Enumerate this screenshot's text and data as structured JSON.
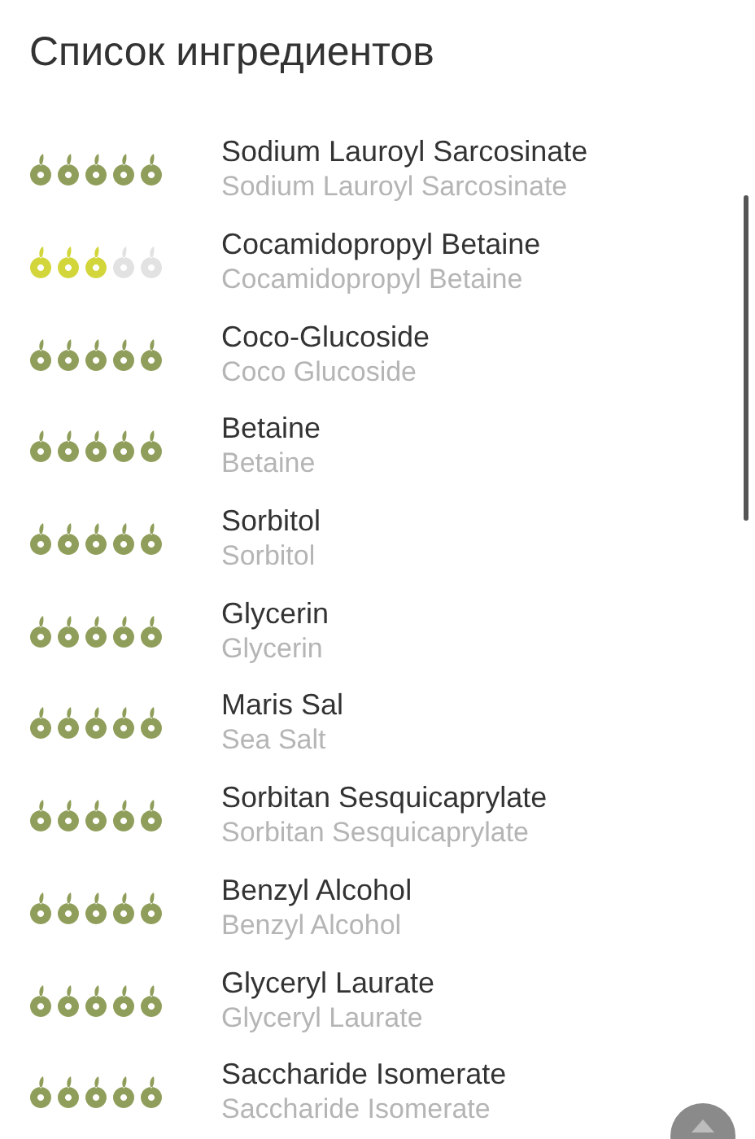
{
  "title": "Список ингредиентов",
  "ingredients": [
    {
      "name": "Sodium Lauroyl Sarcosinate",
      "subtitle": "Sodium Lauroyl Sarcosinate",
      "stars": 5,
      "color": "#8f9e5a"
    },
    {
      "name": "Cocamidopropyl Betaine",
      "subtitle": "Cocamidopropyl Betaine",
      "stars": 3,
      "color": "#d2d63a"
    },
    {
      "name": "Coco-Glucoside",
      "subtitle": "Coco Glucoside",
      "stars": 5,
      "color": "#8f9e5a"
    },
    {
      "name": "Betaine",
      "subtitle": "Betaine",
      "stars": 5,
      "color": "#8f9e5a"
    },
    {
      "name": "Sorbitol",
      "subtitle": "Sorbitol",
      "stars": 5,
      "color": "#8f9e5a"
    },
    {
      "name": "Glycerin",
      "subtitle": "Glycerin",
      "stars": 5,
      "color": "#8f9e5a"
    },
    {
      "name": "Maris Sal",
      "subtitle": "Sea Salt",
      "stars": 5,
      "color": "#8f9e5a"
    },
    {
      "name": "Sorbitan Sesquicaprylate",
      "subtitle": "Sorbitan Sesquicaprylate",
      "stars": 5,
      "color": "#8f9e5a"
    },
    {
      "name": "Benzyl Alcohol",
      "subtitle": "Benzyl Alcohol",
      "stars": 5,
      "color": "#8f9e5a"
    },
    {
      "name": "Glyceryl Laurate",
      "subtitle": "Glyceryl Laurate",
      "stars": 5,
      "color": "#8f9e5a"
    },
    {
      "name": "Saccharide Isomerate",
      "subtitle": "Saccharide Isomerate",
      "stars": 5,
      "color": "#8f9e5a"
    }
  ]
}
